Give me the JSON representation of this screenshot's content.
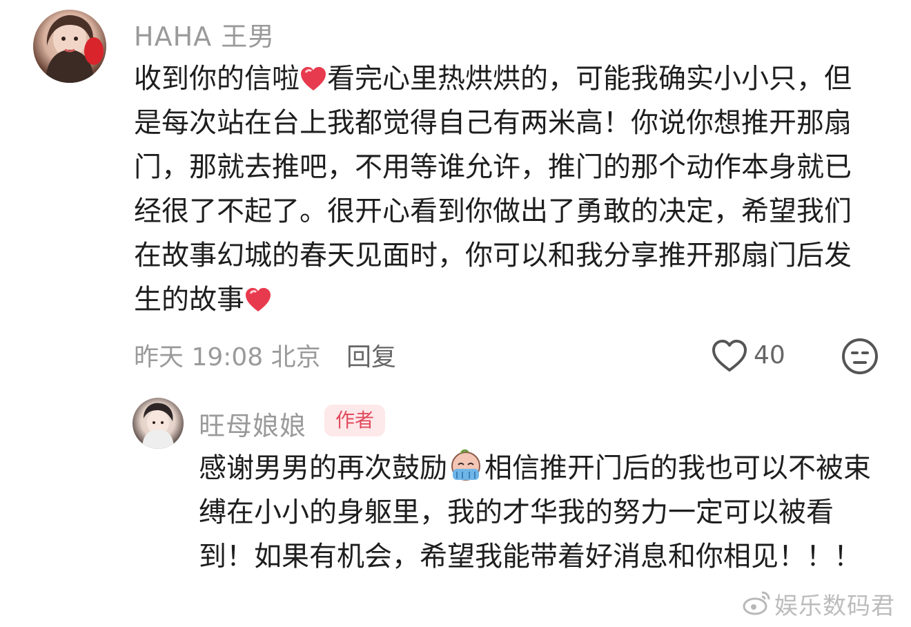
{
  "comment": {
    "username": "HAHA 王男",
    "text_line1": "收到你的信啦",
    "text_after_heart": "看完心里热烘烘的，可能我确实小小只，但是每次站在台上我都觉得自己有两米高！你说你想推开那扇门，那就去推吧，不用等谁允许，推门的那个动作本身就已经很了不起了。很开心看到你做出了勇敢的决定，希望我们在故事幻城的春天见面时，你可以和我分享推开那扇门后发生的故事",
    "meta": "昨天 19:08 北京",
    "reply_label": "回复",
    "like_count": "40",
    "icons": {
      "heart": "heart-emoji",
      "like": "heart-outline-icon",
      "dislike": "sad-face-icon"
    }
  },
  "reply": {
    "username": "旺母娘娘",
    "badge": "作者",
    "text_before_emoji": "感谢男男的再次鼓励",
    "text_after_emoji": "相信推开门后的我也可以不被束缚在小小的身躯里，我的才华我的努力一定可以被看到！如果有机会，希望我能带着好消息和你相见！！！",
    "icons": {
      "emoji": "crying-face-emoji"
    }
  },
  "watermark": {
    "text": "娱乐数码君",
    "icon": "weibo-icon"
  },
  "colors": {
    "username": "#9a9a9a",
    "text": "#1e1e1e",
    "badge_bg": "#fde8ea",
    "badge_text": "#e14a5c",
    "heart": "#e83a4e"
  }
}
